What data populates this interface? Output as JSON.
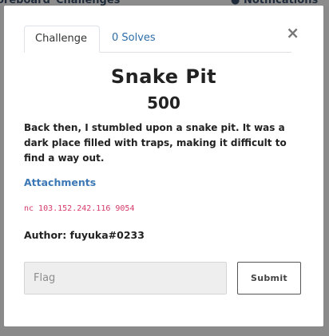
{
  "background_nav": {
    "scoreboard_label": "oreboard",
    "challenges_label": "Challenges",
    "notifications_label": "Notifications"
  },
  "modal": {
    "tabs": [
      {
        "label": "Challenge",
        "active": true
      },
      {
        "label": "0 Solves",
        "active": false
      }
    ],
    "close_symbol": "×",
    "title": "Snake Pit",
    "points": "500",
    "description": "Back then, I stumbled upon a snake pit. It was a dark place filled with traps, making it difficult to find a way out.",
    "attachments_label": "Attachments",
    "connection_info": "nc 103.152.242.116 9054",
    "author": "Author: fuyuka#0233",
    "flag_input": {
      "placeholder": "Flag",
      "value": ""
    },
    "submit_label": "Submit"
  },
  "colors": {
    "link": "#3b78b5",
    "connection_text": "#d63a6b",
    "backdrop": "#8a8a8a"
  }
}
